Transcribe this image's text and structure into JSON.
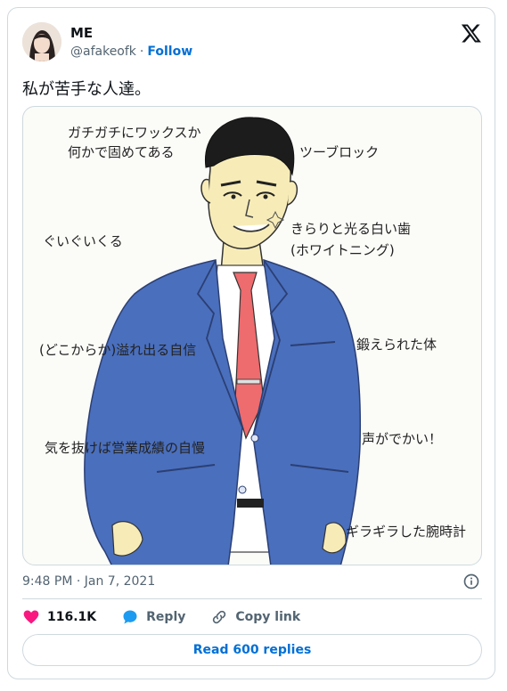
{
  "author": {
    "name": "ME",
    "handle": "@afakeofk",
    "separator": "·",
    "follow_label": "Follow"
  },
  "icons": {
    "brand": "x-logo",
    "like": "heart-icon",
    "reply": "reply-bubble-icon",
    "copy": "link-icon",
    "info": "info-icon"
  },
  "colors": {
    "accent": "#006fd6",
    "like": "#f91880",
    "reply": "#1d9bf0",
    "suit": "#4a6fbd",
    "tie": "#ee6b6e"
  },
  "tweet": {
    "text": "私が苦手な人達。",
    "timestamp": "9:48 PM · Jan 7, 2021"
  },
  "illustration": {
    "annotations": [
      "ガチガチにワックスか何かで固めてある",
      "ツーブロック",
      "きらりと光る白い歯",
      "(ホワイトニング)",
      "ぐいぐいくる",
      "(どこからか)溢れ出る自信",
      "鍛えられた体",
      "声がでかい！",
      "気を抜けば営業成績の自慢",
      "ギラギラした腕時計"
    ]
  },
  "actions": {
    "likes": "116.1K",
    "reply_label": "Reply",
    "copy_label": "Copy link",
    "read_replies": "Read 600 replies"
  }
}
